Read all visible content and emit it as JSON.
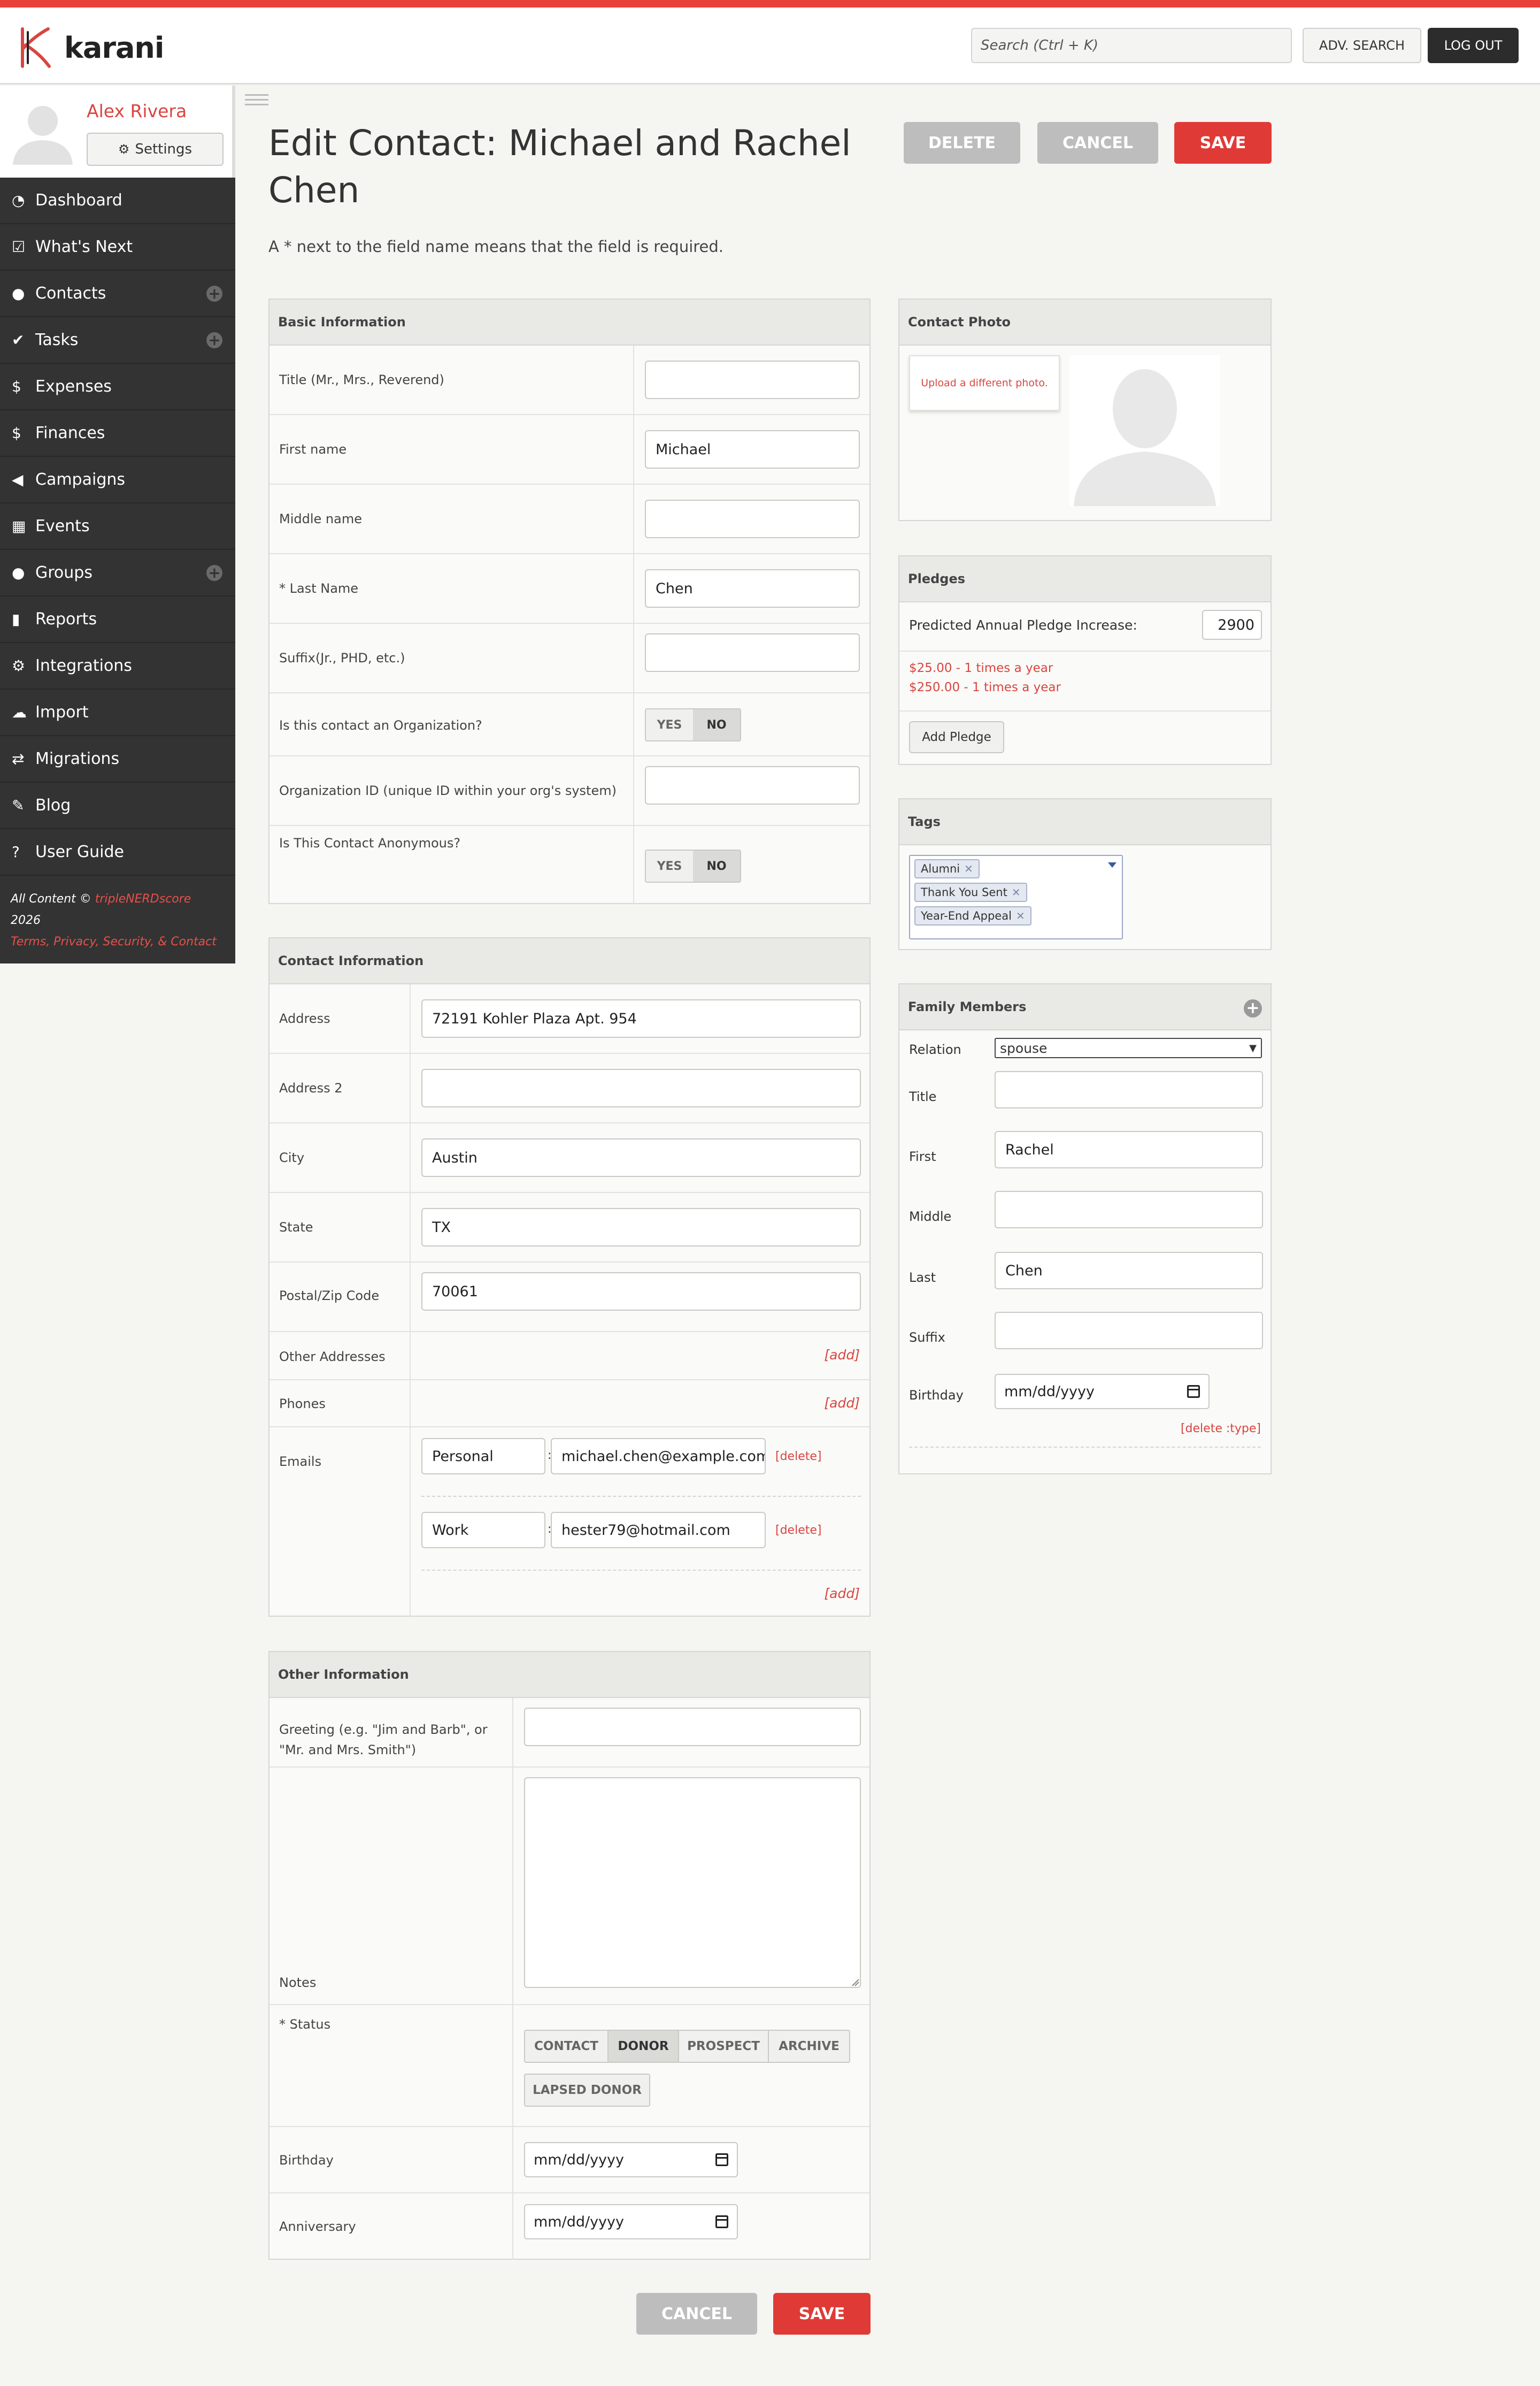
{
  "header": {
    "logo_text": "karani",
    "search_placeholder": "Search (Ctrl + K)",
    "adv_search": "ADV. SEARCH",
    "logout": "LOG OUT"
  },
  "user": {
    "name": "Alex Rivera",
    "settings": "Settings"
  },
  "nav": [
    {
      "label": "Dashboard",
      "icon": "dashboard-icon"
    },
    {
      "label": "What's Next",
      "icon": "checkbox-icon"
    },
    {
      "label": "Contacts",
      "icon": "user-icon",
      "plus": true
    },
    {
      "label": "Tasks",
      "icon": "check-icon",
      "plus": true
    },
    {
      "label": "Expenses",
      "icon": "dollar-icon"
    },
    {
      "label": "Finances",
      "icon": "dollar-icon"
    },
    {
      "label": "Campaigns",
      "icon": "megaphone-icon"
    },
    {
      "label": "Events",
      "icon": "calendar-icon"
    },
    {
      "label": "Groups",
      "icon": "group-icon",
      "plus": true
    },
    {
      "label": "Reports",
      "icon": "bar-chart-icon"
    },
    {
      "label": "Integrations",
      "icon": "gear-icon"
    },
    {
      "label": "Import",
      "icon": "upload-icon"
    },
    {
      "label": "Migrations",
      "icon": "swap-icon"
    },
    {
      "label": "Blog",
      "icon": "pencil-icon"
    },
    {
      "label": "User Guide",
      "icon": "question-icon"
    }
  ],
  "footer": {
    "prefix": "All Content © ",
    "brand": "tripleNERDscore",
    "year": " 2026",
    "links": "Terms, Privacy, Security, & Contact"
  },
  "page": {
    "title": "Edit Contact: Michael and Rachel Chen",
    "required_note": "A * next to the field name means that the field is required.",
    "delete": "DELETE",
    "cancel": "CANCEL",
    "save": "SAVE"
  },
  "basic": {
    "heading": "Basic Information",
    "title_label": "Title (Mr., Mrs., Reverend)",
    "title_value": "",
    "first_label": "First name",
    "first_value": "Michael",
    "middle_label": "Middle name",
    "middle_value": "",
    "last_label": "* Last Name",
    "last_value": "Chen",
    "suffix_label": "Suffix(Jr., PHD, etc.)",
    "suffix_value": "",
    "org_label": "Is this contact an Organization?",
    "orgid_label": "Organization ID (unique ID within your org's system)",
    "orgid_value": "",
    "anon_label": "Is This Contact Anonymous?",
    "yes": "YES",
    "no": "NO"
  },
  "contact": {
    "heading": "Contact Information",
    "address_label": "Address",
    "address_value": "72191 Kohler Plaza Apt. 954",
    "address2_label": "Address 2",
    "address2_value": "",
    "city_label": "City",
    "city_value": "Austin",
    "state_label": "State",
    "state_value": "TX",
    "zip_label": "Postal/Zip Code",
    "zip_value": "70061",
    "other_addresses_label": "Other Addresses",
    "phones_label": "Phones",
    "emails_label": "Emails",
    "emails": [
      {
        "type": "Personal",
        "address": "michael.chen@example.com"
      },
      {
        "type": "Work",
        "address": "hester79@hotmail.com"
      }
    ],
    "add": "[add]",
    "delete": "[delete]"
  },
  "other": {
    "heading": "Other Information",
    "greeting_label": "Greeting (e.g. \"Jim and Barb\", or \"Mr. and Mrs. Smith\")",
    "greeting_value": "",
    "notes_label": "Notes",
    "notes_value": "",
    "status_label": "* Status",
    "statuses": [
      "CONTACT",
      "DONOR",
      "PROSPECT",
      "ARCHIVE",
      "LAPSED DONOR"
    ],
    "status_selected": "DONOR",
    "birthday_label": "Birthday",
    "anniversary_label": "Anniversary",
    "date_placeholder": "mm/dd/yyyy"
  },
  "photo": {
    "heading": "Contact Photo",
    "upload": "Upload a different photo."
  },
  "pledges": {
    "heading": "Pledges",
    "predicted_label": "Predicted Annual Pledge Increase:",
    "predicted_value": "2900",
    "items": [
      "$25.00 - 1 times a year",
      "$250.00 - 1 times a year"
    ],
    "add": "Add Pledge"
  },
  "tags": {
    "heading": "Tags",
    "items": [
      "Alumni",
      "Thank You Sent",
      "Year-End Appeal"
    ]
  },
  "family": {
    "heading": "Family Members",
    "relation_label": "Relation",
    "relation_value": "spouse",
    "title_label": "Title",
    "title_value": "",
    "first_label": "First",
    "first_value": "Rachel",
    "middle_label": "Middle",
    "middle_value": "",
    "last_label": "Last",
    "last_value": "Chen",
    "suffix_label": "Suffix",
    "suffix_value": "",
    "birthday_label": "Birthday",
    "birthday_placeholder": "mm/dd/yyyy",
    "delete_type": "[delete :type]"
  },
  "colors": {
    "accent": "#e03a36",
    "sidebar": "#333333",
    "link": "#d9453f"
  }
}
